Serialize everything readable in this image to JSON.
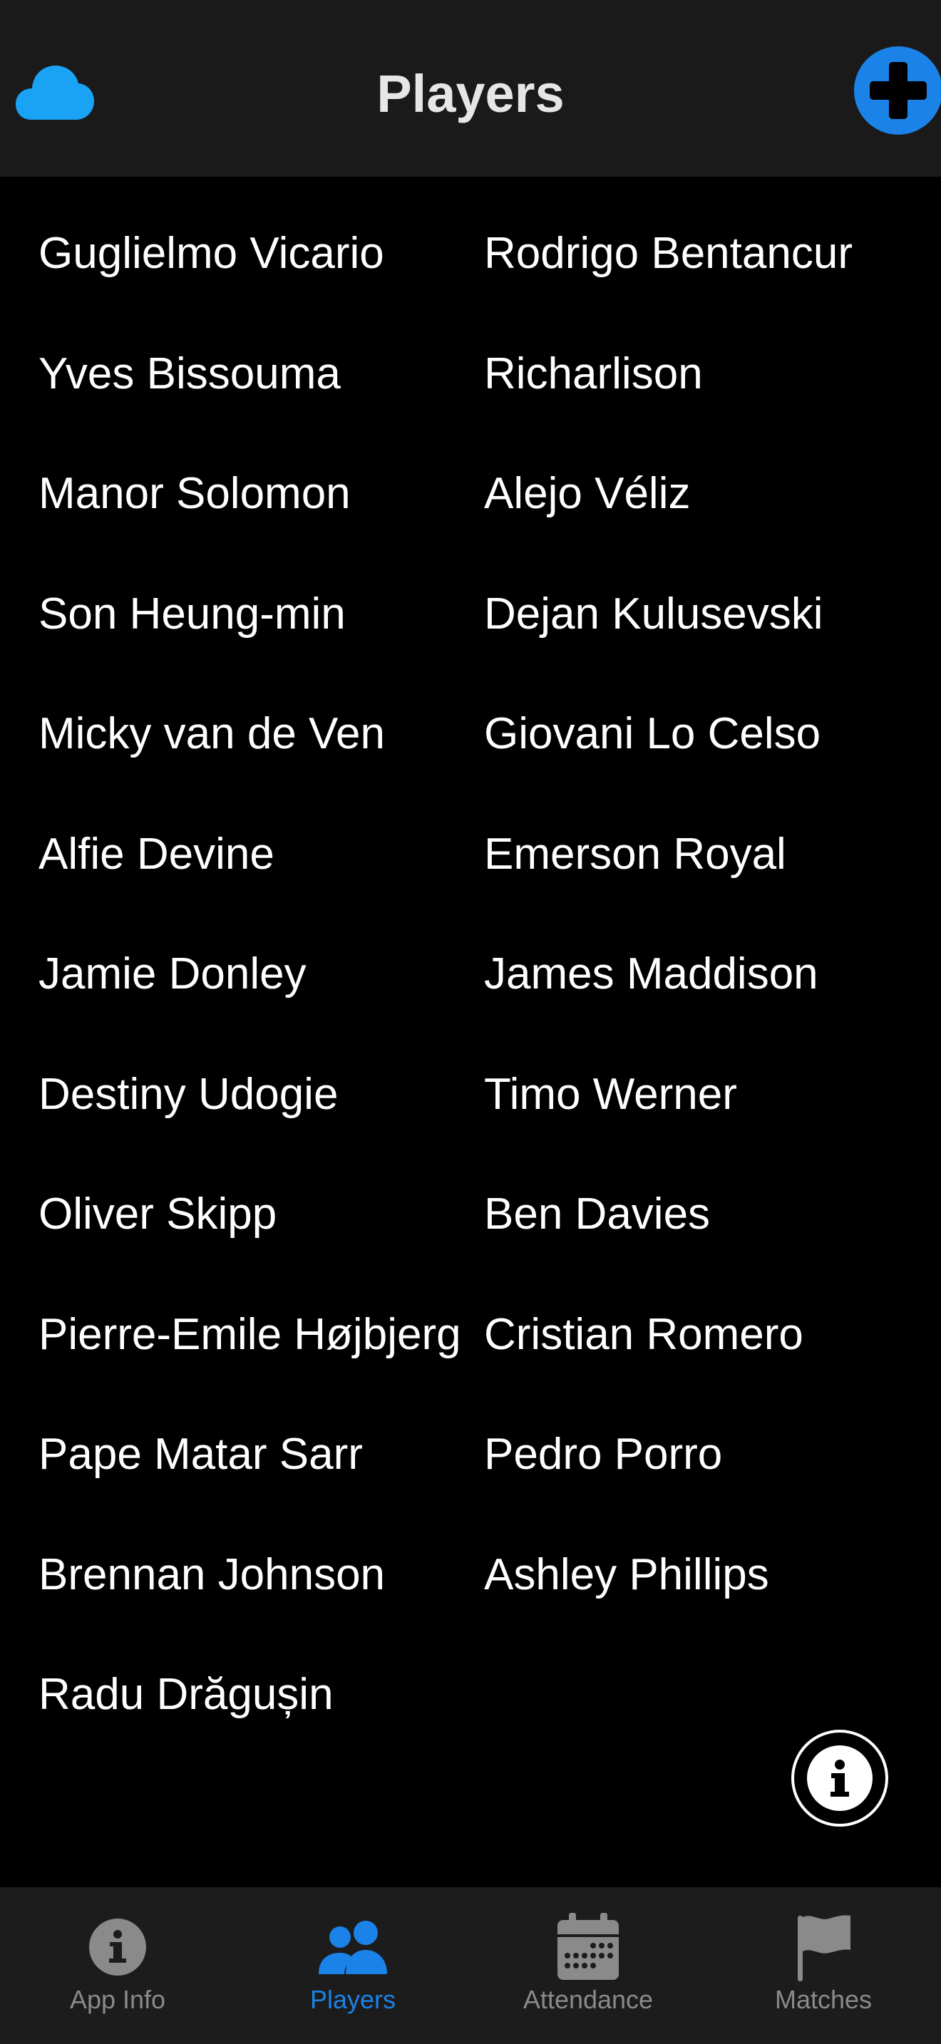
{
  "header": {
    "title": "Players",
    "left_icon": "cloud-icon",
    "right_icon": "plus-circle-icon"
  },
  "players": [
    "Guglielmo Vicario",
    "Rodrigo Bentancur",
    "Yves Bissouma",
    "Richarlison",
    "Manor Solomon",
    "Alejo Véliz",
    "Son Heung-min",
    "Dejan Kulusevski",
    "Micky van de Ven",
    "Giovani Lo Celso",
    "Alfie Devine",
    "Emerson Royal",
    "Jamie Donley",
    "James Maddison",
    "Destiny Udogie",
    "Timo Werner",
    "Oliver Skipp",
    "Ben Davies",
    "Pierre-Emile Højbjerg",
    "Cristian Romero",
    "Pape Matar Sarr",
    "Pedro Porro",
    "Brennan Johnson",
    "Ashley Phillips",
    "Radu Drăgușin"
  ],
  "fab": {
    "icon": "info-circle-icon"
  },
  "tabs": [
    {
      "label": "App Info",
      "icon": "info-icon",
      "active": false
    },
    {
      "label": "Players",
      "icon": "people-icon",
      "active": true
    },
    {
      "label": "Attendance",
      "icon": "calendar-icon",
      "active": false
    },
    {
      "label": "Matches",
      "icon": "flag-icon",
      "active": false
    }
  ],
  "colors": {
    "accent": "#1b82e8",
    "cloud": "#1aa3f5",
    "header_bg": "#1a1a1a",
    "tabbar_bg": "#1c1c1c",
    "inactive": "#8a8a8a"
  }
}
